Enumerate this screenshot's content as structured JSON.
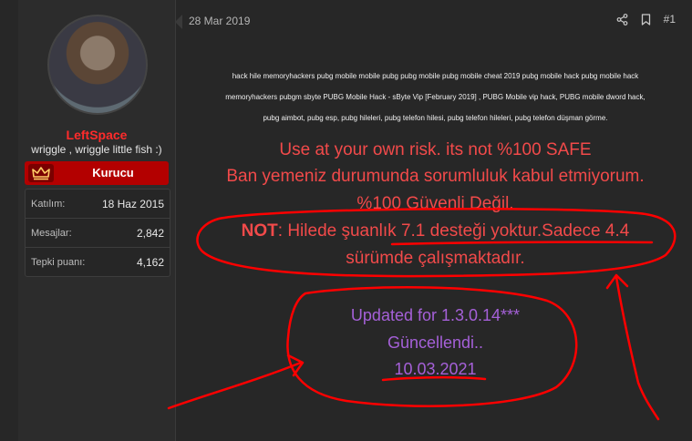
{
  "author": {
    "name": "LeftSpace",
    "title": "wriggle , wriggle little fish :)",
    "banner": "Kurucu",
    "stats": [
      {
        "label": "Katılım:",
        "value": "18 Haz 2015"
      },
      {
        "label": "Mesajlar:",
        "value": "2,842"
      },
      {
        "label": "Tepki puanı:",
        "value": "4,162"
      }
    ]
  },
  "post": {
    "date": "28 Mar 2019",
    "number": "#1",
    "keywords_lines": [
      "hack hile memoryhackers pubg mobile mobile pubg pubg mobile pubg mobile cheat 2019 pubg mobile hack pubg mobile hack",
      "memoryhackers pubgm sbyte PUBG Mobile Hack - sByte Vip [February 2019] , PUBG Mobile vip hack, PUBG mobile dword hack,",
      "pubg aimbot, pubg esp, pubg hileleri, pubg telefon hilesi, pubg telefon hileleri, pubg telefon düşman görme."
    ],
    "warning_lines": [
      "Use at your own risk. its not %100 SAFE",
      "Ban yemeniz durumunda sorumluluk kabul etmiyorum.",
      "%100 Güvenli Değil."
    ],
    "note_label": "NOT",
    "note_text": ": Hilede şuanlık 7.1 desteği yoktur.Sadece 4.4",
    "note_text_2": "sürümde çalışmaktadır.",
    "update_lines": [
      "Updated for 1.3.0.14***",
      "Güncellendi..",
      "10.03.2021"
    ]
  },
  "icons": {
    "share": "share-icon",
    "bookmark": "bookmark-icon",
    "crown": "crown-icon"
  },
  "colors": {
    "username": "#ff2b2b",
    "banner": "#b30000",
    "warning_text": "#f24a4a",
    "update_text": "#a560d8",
    "scribble": "#ff0000"
  }
}
